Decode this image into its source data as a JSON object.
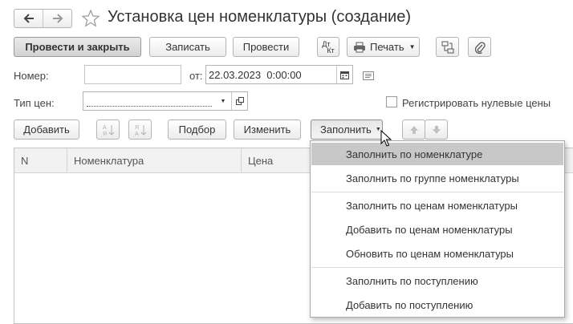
{
  "header": {
    "title": "Установка цен номенклатуры (создание)"
  },
  "toolbar": {
    "post_and_close_label": "Провести и закрыть",
    "save_label": "Записать",
    "post_label": "Провести",
    "dt_kt_label_top": "Дт",
    "dt_kt_label_bottom": "Кт",
    "print_label": "Печать"
  },
  "form": {
    "number_label": "Номер:",
    "number_value": "",
    "date_label": "от:",
    "date_value": "22.03.2023  0:00:00",
    "price_type_label": "Тип цен:",
    "price_type_value": "",
    "register_zero_label": "Регистрировать нулевые цены",
    "register_zero_checked": false
  },
  "table_toolbar": {
    "add_label": "Добавить",
    "pick_label": "Подбор",
    "change_label": "Изменить",
    "fill_label": "Заполнить"
  },
  "table": {
    "columns": [
      "N",
      "Номенклатура",
      "Цена"
    ],
    "rows": []
  },
  "fill_menu": {
    "items": [
      "Заполнить по номенклатуре",
      "Заполнить по группе номенклатуры",
      "Заполнить по ценам номенклатуры",
      "Добавить по ценам номенклатуры",
      "Обновить по ценам номенклатуры",
      "Заполнить по поступлению",
      "Добавить по поступлению"
    ],
    "highlighted_index": 0
  },
  "icons": {
    "back": "arrow-left-icon",
    "forward": "arrow-right-icon",
    "favorite": "star-icon",
    "print": "printer-icon",
    "structure": "document-structure-icon",
    "attach": "paperclip-icon",
    "calendar": "calendar-icon",
    "comment": "comment-icon",
    "open": "open-form-icon",
    "sort_asc": "sort-ascending-icon",
    "sort_desc": "sort-descending-icon",
    "move_up": "arrow-up-icon",
    "move_down": "arrow-down-icon",
    "cursor": "mouse-pointer-icon"
  }
}
